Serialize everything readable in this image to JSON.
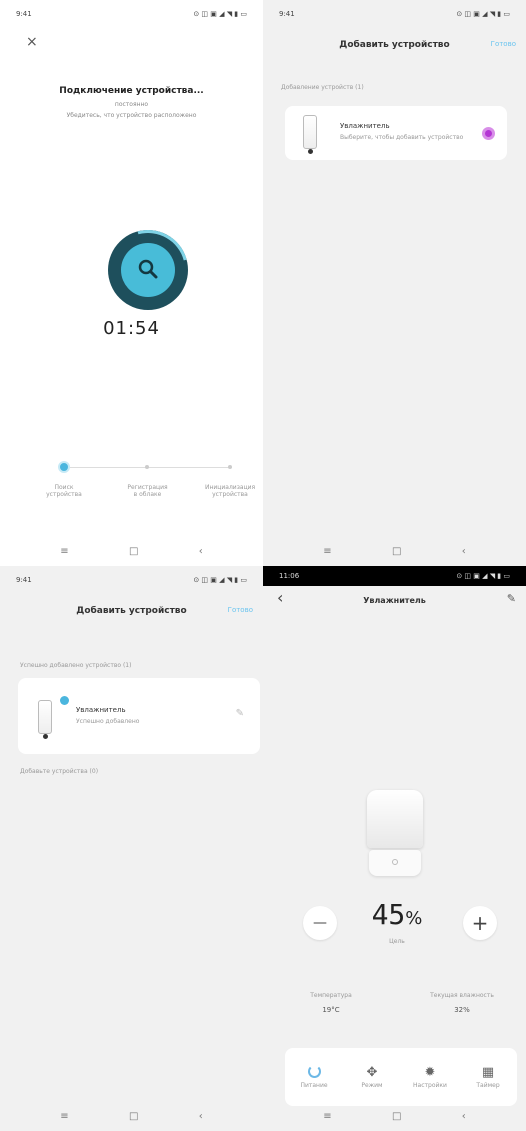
{
  "panel1": {
    "status_time": "9:41",
    "status_icons": "⊙ ◫ ▣ ◢ ◥ ▮ ▭",
    "close_icon": "×",
    "title": "Подключение устройства...",
    "subtitle1": "постоянно",
    "subtitle2": "Убедитесь, что устройство расположено",
    "timer": "01:54",
    "steps": [
      "Поиск устройства",
      "Регистрация в облаке",
      "Инициализация устройства"
    ],
    "nav": [
      "≡",
      "□",
      "‹"
    ]
  },
  "panel2": {
    "status_time": "9:41",
    "status_icons": "⊙ ◫ ▣ ◢ ◥ ▮ ▭",
    "title": "Добавить устройство",
    "action": "Готово",
    "section": "Добавление устройств (1)",
    "device_name": "Увлажнитель",
    "device_desc": "Выберите, чтобы добавить устройство",
    "nav": [
      "≡",
      "□",
      "‹"
    ]
  },
  "panel3": {
    "status_time": "9:41",
    "status_icons": "⊙ ◫ ▣ ◢ ◥ ▮ ▭",
    "title": "Добавить устройство",
    "action": "Готово",
    "section": "Успешно добавлено устройство (1)",
    "device_name": "Увлажнитель",
    "device_desc": "Успешно добавлено",
    "section2": "Добавьте устройства (0)",
    "nav": [
      "≡",
      "□",
      "‹"
    ]
  },
  "panel4": {
    "status_time": "11:06",
    "status_icons": "⊙ ◫ ▣ ◢ ◥ ▮ ▭",
    "back_icon": "‹",
    "title": "Увлажнитель",
    "edit_icon": "✎",
    "value": "45",
    "unit": "%",
    "value_label": "Цель",
    "minus": "—",
    "plus": "+",
    "stat1_label": "Температура",
    "stat1_value": "19°C",
    "stat2_label": "Текущая влажность",
    "stat2_value": "32%",
    "tabs": [
      "Питание",
      "Режим",
      "Настройки",
      "Таймер"
    ],
    "nav": [
      "≡",
      "□",
      "‹"
    ]
  }
}
